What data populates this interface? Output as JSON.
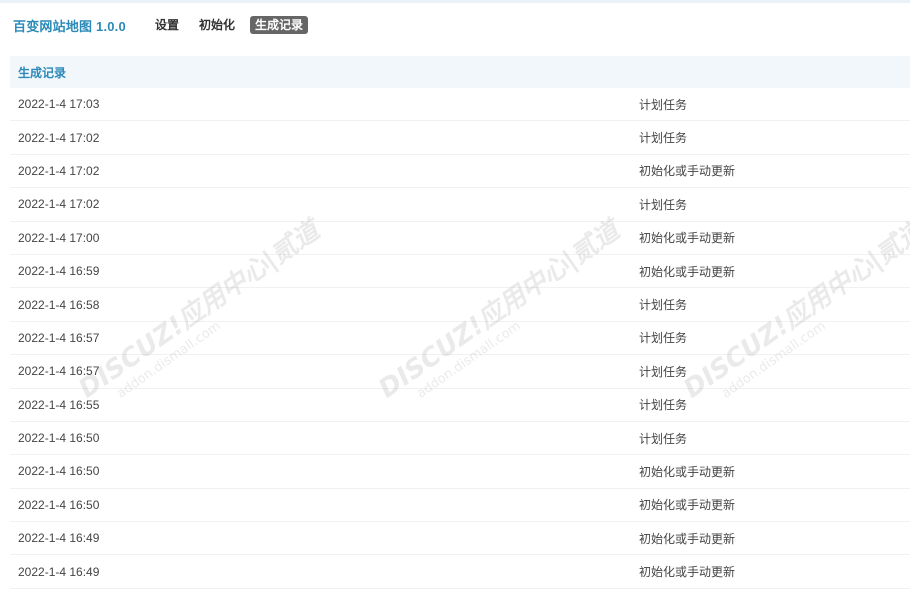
{
  "header": {
    "app_title": "百变网站地图 1.0.0",
    "tabs": [
      {
        "label": "设置",
        "active": false
      },
      {
        "label": "初始化",
        "active": false
      },
      {
        "label": "生成记录",
        "active": true
      }
    ]
  },
  "panel": {
    "title": "生成记录",
    "rows": [
      {
        "time": "2022-1-4 17:03",
        "type": "计划任务"
      },
      {
        "time": "2022-1-4 17:02",
        "type": "计划任务"
      },
      {
        "time": "2022-1-4 17:02",
        "type": "初始化或手动更新"
      },
      {
        "time": "2022-1-4 17:02",
        "type": "计划任务"
      },
      {
        "time": "2022-1-4 17:00",
        "type": "初始化或手动更新"
      },
      {
        "time": "2022-1-4 16:59",
        "type": "初始化或手动更新"
      },
      {
        "time": "2022-1-4 16:58",
        "type": "计划任务"
      },
      {
        "time": "2022-1-4 16:57",
        "type": "计划任务"
      },
      {
        "time": "2022-1-4 16:57",
        "type": "计划任务"
      },
      {
        "time": "2022-1-4 16:55",
        "type": "计划任务"
      },
      {
        "time": "2022-1-4 16:50",
        "type": "计划任务"
      },
      {
        "time": "2022-1-4 16:50",
        "type": "初始化或手动更新"
      },
      {
        "time": "2022-1-4 16:50",
        "type": "初始化或手动更新"
      },
      {
        "time": "2022-1-4 16:49",
        "type": "初始化或手动更新"
      },
      {
        "time": "2022-1-4 16:49",
        "type": "初始化或手动更新"
      }
    ]
  },
  "watermark": {
    "main": "DISCUZ!应用中心|贰道",
    "sub": "addon.dismall.com"
  },
  "colors": {
    "accent": "#2b8ab8",
    "active_tab_bg": "#666666",
    "panel_head_bg": "#f2f7fc"
  }
}
